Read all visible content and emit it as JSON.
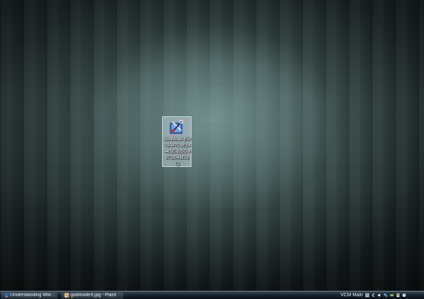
{
  "desktop": {
    "icon": {
      "label": "GodMode.{ED7BA470-8E54-465E-825C-99712043E01C}",
      "icon_name": "control-panel-tools-icon"
    }
  },
  "taskbar": {
    "tasks": [
      {
        "label": "Understanding Win...",
        "icon_name": "firefox-icon"
      },
      {
        "label": "godmode3.jpg - Paint",
        "icon_name": "paint-icon"
      }
    ],
    "tray": {
      "toolbar_label": "VCM Main",
      "icons": [
        "toolbar-toggle-icon",
        "tray-overflow-icon",
        "volume-icon",
        "network-icon",
        "power-icon",
        "safely-remove-icon",
        "clock-icon"
      ]
    }
  },
  "colors": {
    "wood_dark": "#1e2828",
    "wood_mid": "#3f5252",
    "taskbar": "#1a242e"
  }
}
